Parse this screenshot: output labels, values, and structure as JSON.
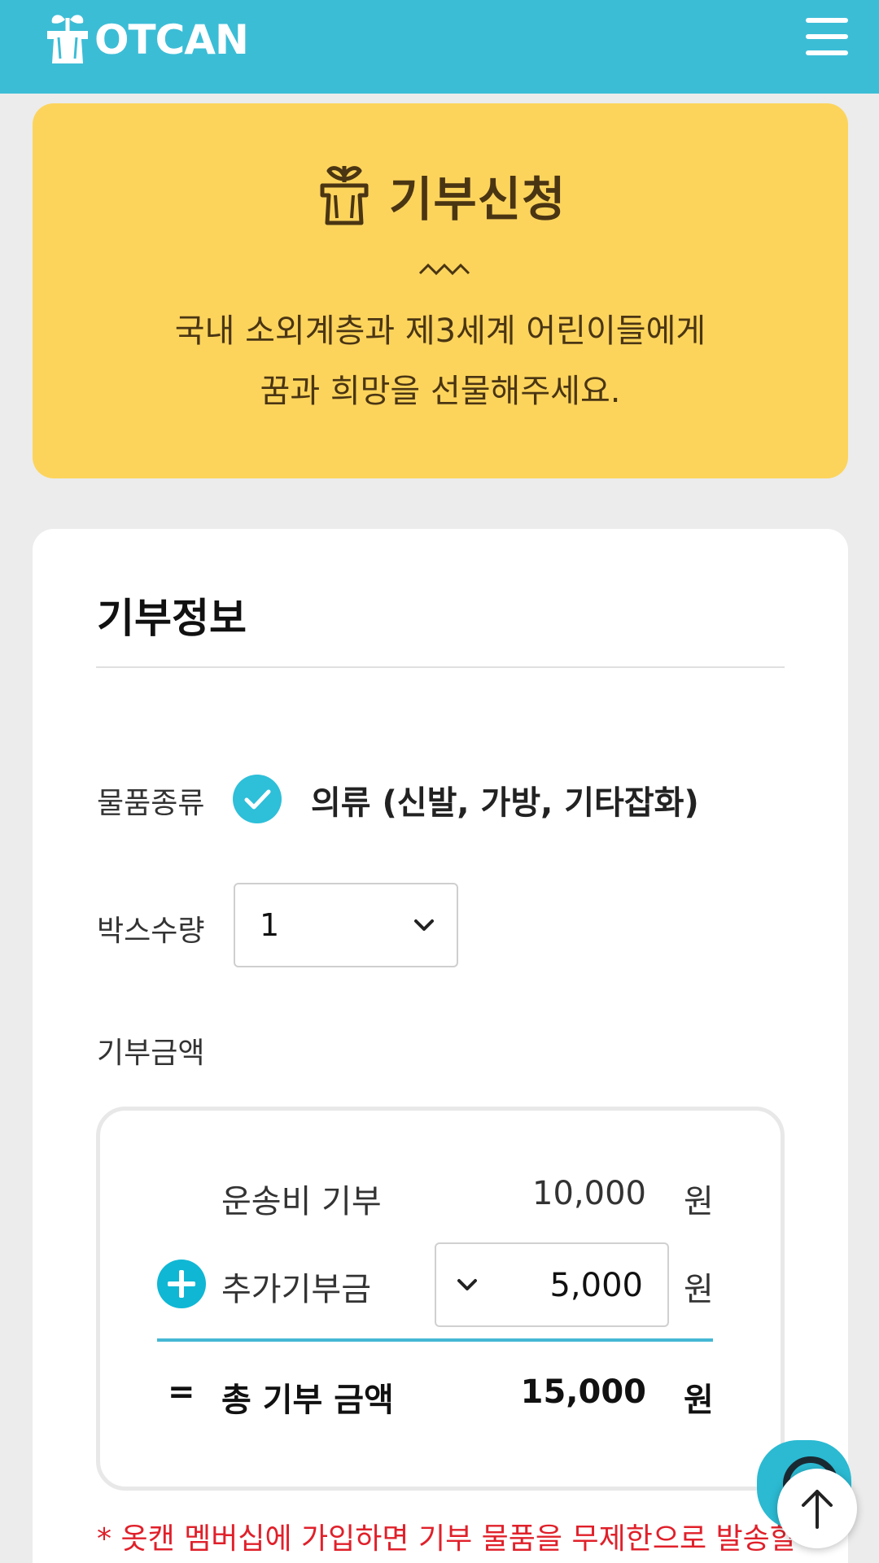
{
  "header": {
    "logo_text": "OTCAN",
    "menu_icon": "hamburger-menu-icon",
    "background_color": "#3cbdd6"
  },
  "banner": {
    "title": "기부신청",
    "icon": "plant-pot-icon",
    "description_line1": "국내 소외계층과 제3세계 어린이들에게",
    "description_line2": "꿈과 희망을 선물해주세요.",
    "background_color": "#fcd45c"
  },
  "donation_info": {
    "section_title": "기부정보",
    "item_type_label": "물품종류",
    "item_type_value": "의류 (신발, 가방, 기타잡화)",
    "box_count_label": "박스수량",
    "box_count_value": "1",
    "amount_label": "기부금액",
    "calc": {
      "shipping_label": "운송비 기부",
      "shipping_amount": "10,000",
      "shipping_unit": "원",
      "extra_label": "추가기부금",
      "extra_amount": "5,000",
      "extra_unit": "원",
      "total_symbol": "=",
      "total_label": "총 기부 금액",
      "total_amount": "15,000",
      "total_unit": "원"
    },
    "notice": "* 옷캔 멤버십에 가입하면 기부 물품을 무제한으로 발송할"
  },
  "floating": {
    "chat_icon": "chat-bubble-icon",
    "scroll_top_icon": "arrow-up-icon"
  },
  "colors": {
    "accent": "#2ebfd9",
    "notice_red": "#e0202a"
  }
}
